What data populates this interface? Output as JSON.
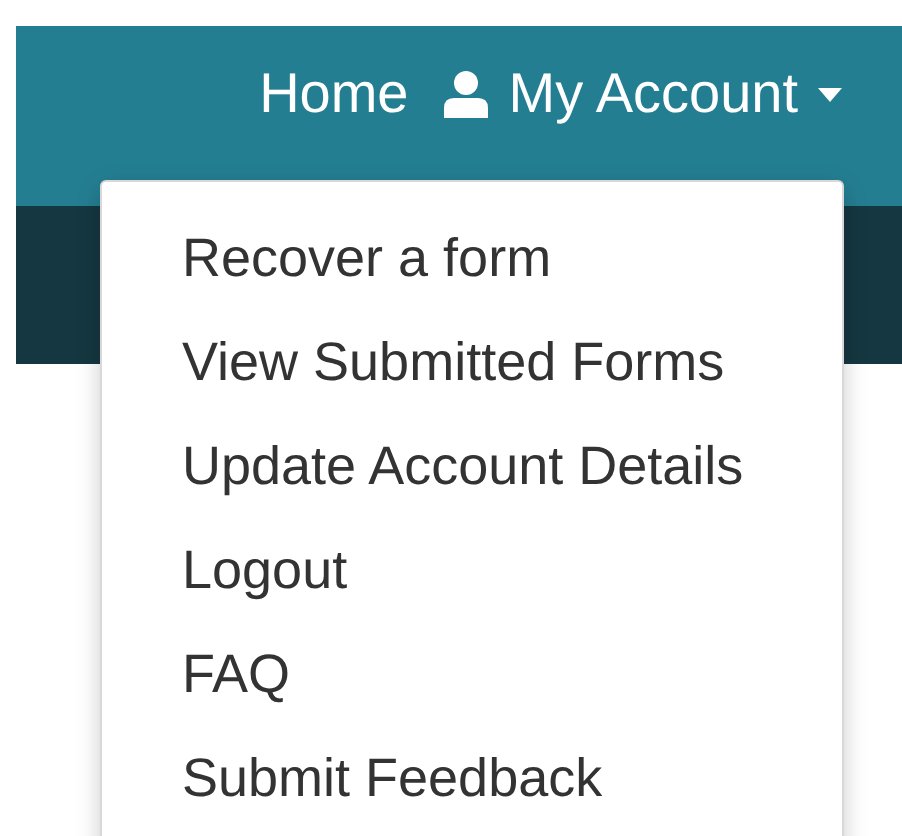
{
  "nav": {
    "links": [
      {
        "label": "Home"
      },
      {
        "label": "My Account",
        "kind": "dropdown",
        "expanded": true
      }
    ]
  },
  "dropdown": {
    "items": [
      {
        "label": "Recover a form"
      },
      {
        "label": "View Submitted Forms"
      },
      {
        "label": "Update Account Details"
      },
      {
        "label": "Logout"
      },
      {
        "label": "FAQ"
      },
      {
        "label": "Submit Feedback"
      }
    ]
  }
}
